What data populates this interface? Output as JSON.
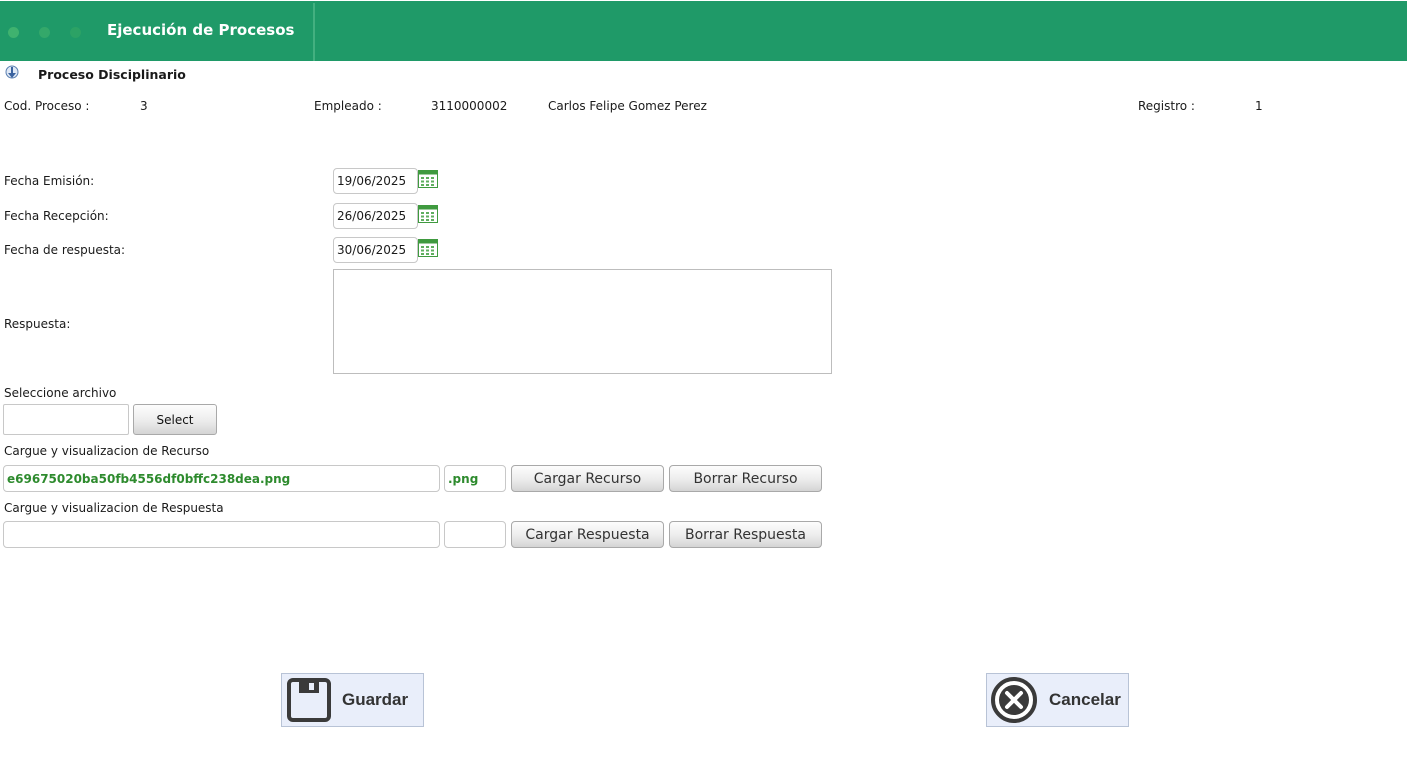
{
  "header": {
    "title": "Ejecución de Procesos",
    "dots": [
      "#3fb26f",
      "#34a86a",
      "#2ca265"
    ]
  },
  "section": {
    "title": "Proceso Disciplinario",
    "icon": "info-download-icon"
  },
  "info": {
    "cod_label": "Cod. Proceso :",
    "cod_value": "3",
    "empleado_label": "Empleado :",
    "empleado_id": "3110000002",
    "empleado_name": "Carlos Felipe Gomez Perez",
    "registro_label": "Registro :",
    "registro_value": "1"
  },
  "form": {
    "fecha_emision_label": "Fecha Emisión:",
    "fecha_emision_value": "19/06/2025",
    "fecha_recepcion_label": "Fecha Recepción:",
    "fecha_recepcion_value": "26/06/2025",
    "fecha_respuesta_label": "Fecha de respuesta:",
    "fecha_respuesta_value": "30/06/2025",
    "respuesta_label": "Respuesta:",
    "respuesta_value": "",
    "calendar_icon": "calendar-icon"
  },
  "file": {
    "select_label": "Seleccione archivo",
    "select_button": "Select",
    "recurso_label": "Cargue y visualizacion de Recurso",
    "recurso_filename": "e69675020ba50fb4556df0bffc238dea.png",
    "recurso_ext": ".png",
    "cargar_recurso": "Cargar Recurso",
    "borrar_recurso": "Borrar Recurso",
    "respuesta_label": "Cargue y visualizacion de Respuesta",
    "respuesta_filename": "",
    "respuesta_ext": "",
    "cargar_respuesta": "Cargar Respuesta",
    "borrar_respuesta": "Borrar Respuesta"
  },
  "actions": {
    "guardar": "Guardar",
    "guardar_icon": "save-icon",
    "cancelar": "Cancelar",
    "cancelar_icon": "cancel-icon"
  },
  "colors": {
    "header": "#1f9a68",
    "filename_green": "#2e8b2e",
    "action_button_bg": "#e9eefa"
  }
}
